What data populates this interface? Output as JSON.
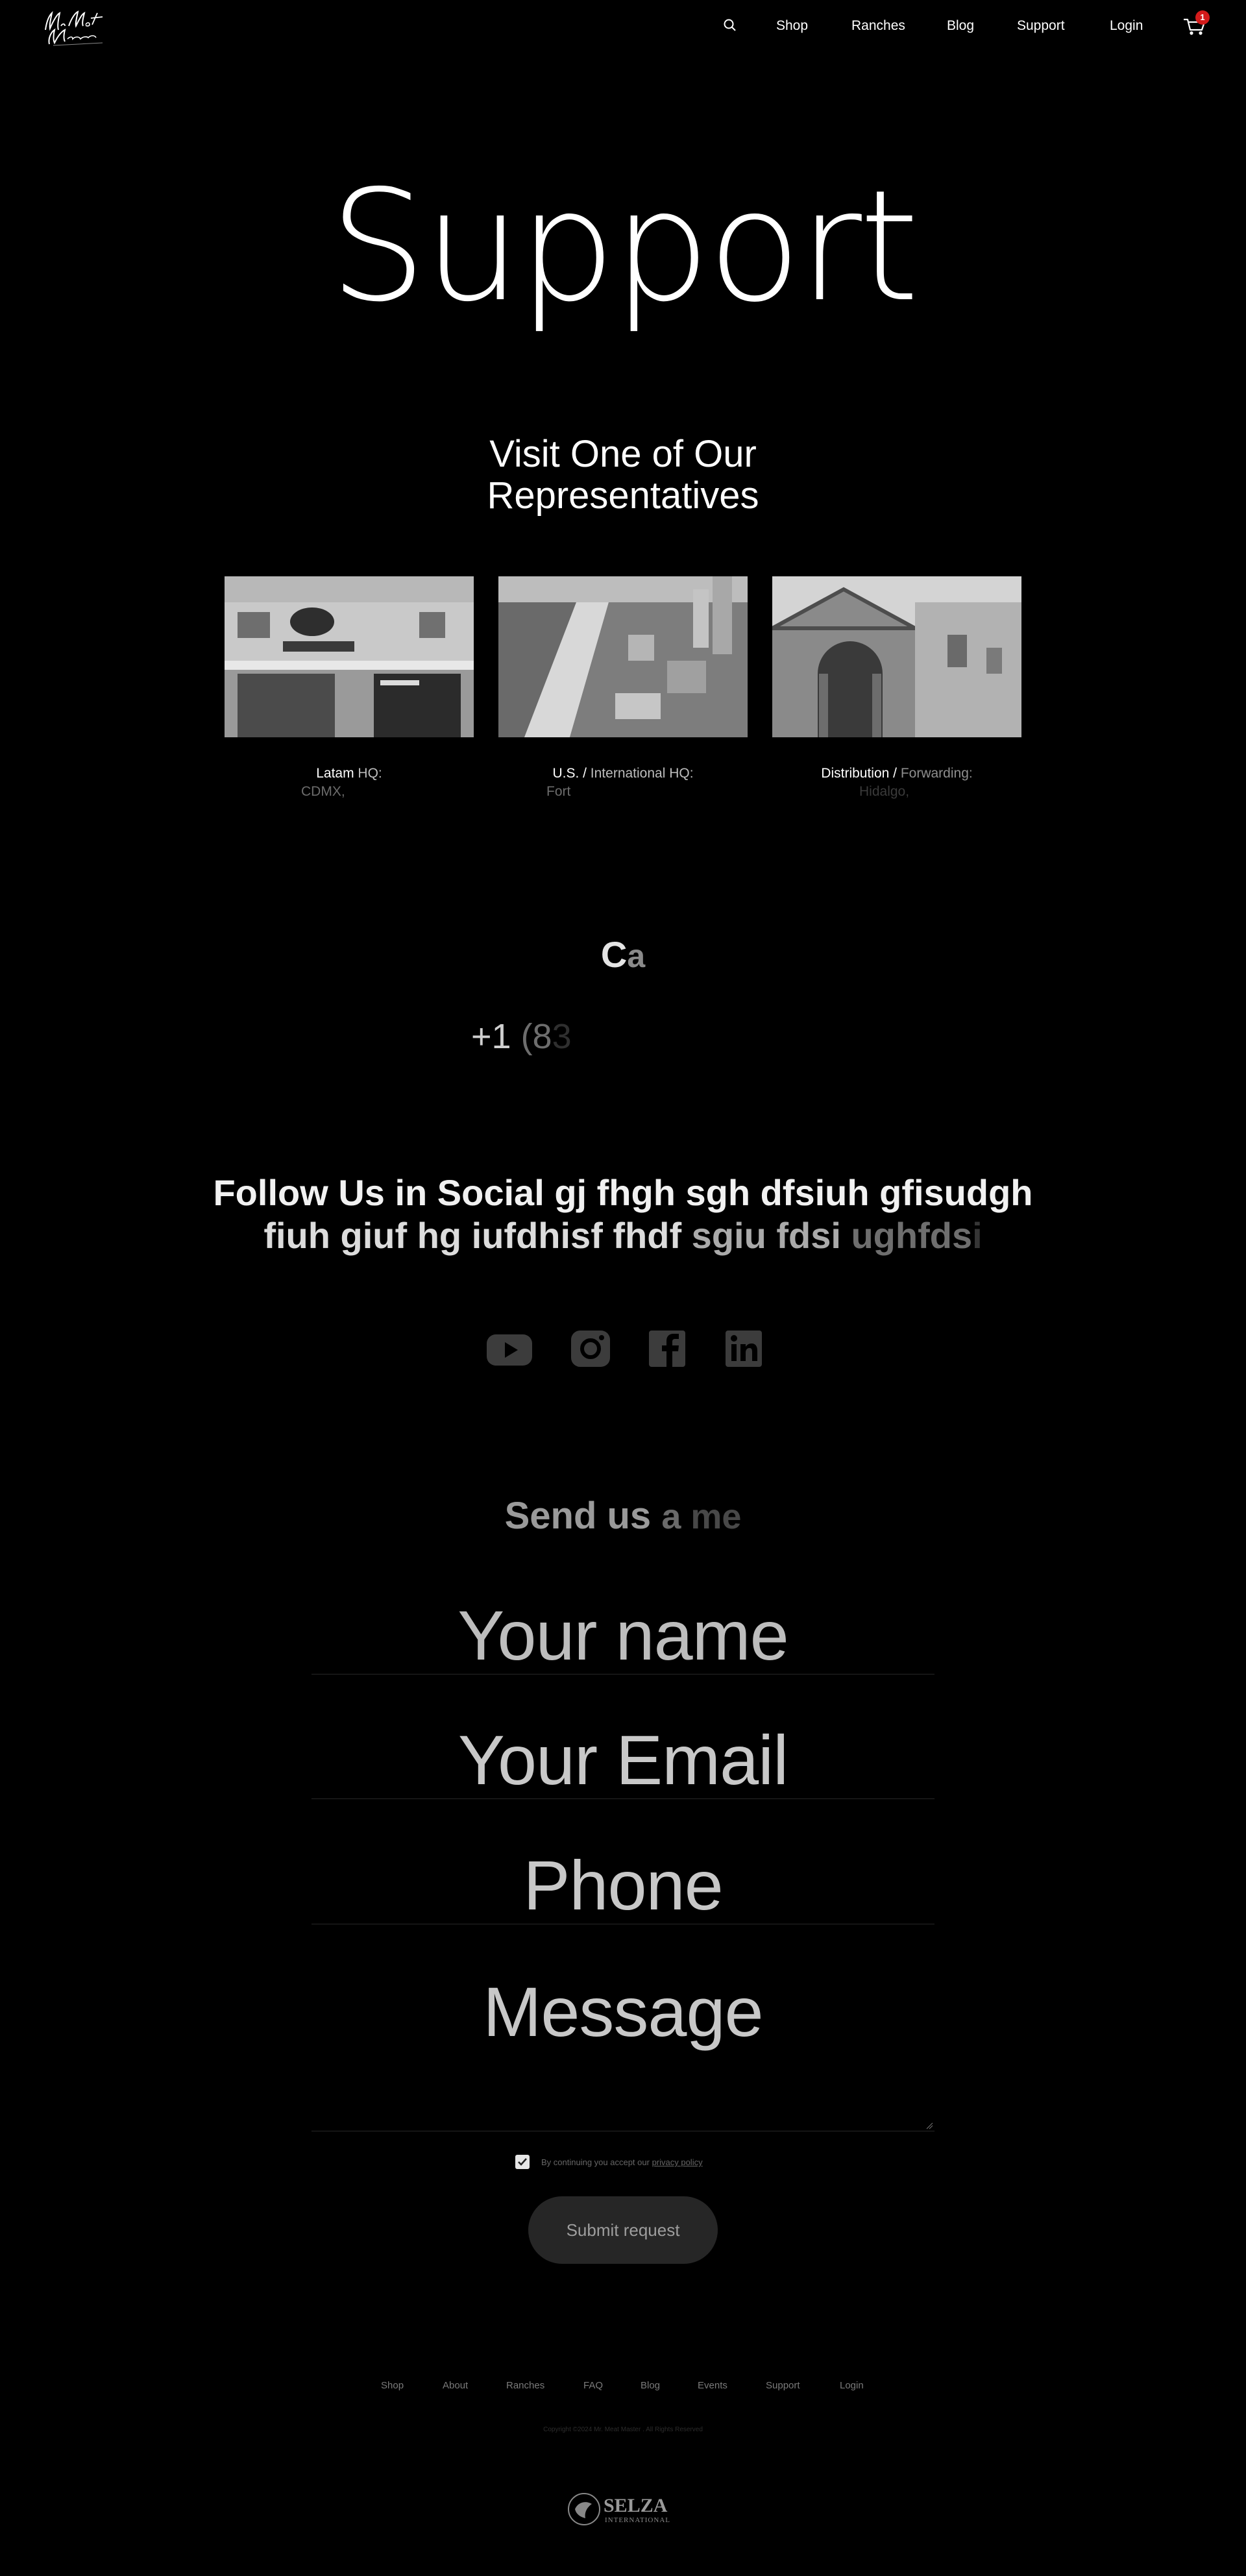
{
  "header": {
    "logo_text": "Mr. Meat Master",
    "nav": {
      "shop": "Shop",
      "ranches": "Ranches",
      "blog": "Blog",
      "support": "Support",
      "login": "Login"
    },
    "cart_count": "1"
  },
  "hero": {
    "title": "Support"
  },
  "representatives": {
    "title_line1": "Visit One of Our",
    "title_line2": "Representatives",
    "cards": [
      {
        "title_a": "Latam",
        "title_b": " HQ:",
        "address": "CDMX,",
        "image": "storefront-photo"
      },
      {
        "title_a": "U.S. / ",
        "title_b": "International HQ:",
        "address": "Fort",
        "image": "beach-city-aerial-photo"
      },
      {
        "title_a": "Distribution / ",
        "title_b": "Forwarding:",
        "address": "Hidalgo,",
        "image": "stone-church-photo"
      }
    ]
  },
  "call": {
    "title_a": "C",
    "title_b": "a",
    "phone_a": "+1 ",
    "phone_b": "(8",
    "phone_c": "3"
  },
  "social": {
    "line1": "Follow Us in Social gj fhgh sgh dfsiuh gfisudgh",
    "line2_a": "fiuh giuf hg iufdhisf fhdf ",
    "line2_b": "sgiu fdsi ",
    "line2_c": "ughfds",
    "line2_d": "i",
    "icons": [
      "youtube-icon",
      "instagram-icon",
      "facebook-icon",
      "linkedin-icon"
    ]
  },
  "form": {
    "title_a": "Send us ",
    "title_b": "a ",
    "title_c": "me",
    "name_placeholder": "Your name",
    "email_placeholder": "Your Email",
    "phone_placeholder": "Phone",
    "message_placeholder": "Message",
    "privacy_text": "By continuing you accept our ",
    "privacy_link": "privacy policy",
    "checkbox_checked": true,
    "submit_label": "Submit request"
  },
  "footer": {
    "links": [
      "Shop",
      "About",
      "Ranches",
      "FAQ",
      "Blog",
      "Events",
      "Support",
      "Login"
    ],
    "copyright": "Copyright ©2024 Mr. Meat Master . All Rights Reserved",
    "partner_logo": "SELZA",
    "partner_logo_sub": "INTERNATIONAL"
  }
}
